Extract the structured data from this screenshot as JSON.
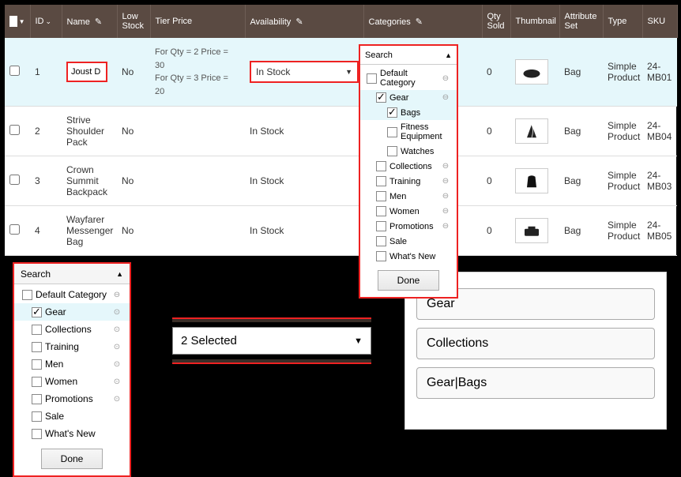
{
  "headers": {
    "id": "ID",
    "name": "Name",
    "low_stock": "Low Stock",
    "tier_price": "Tier Price",
    "availability": "Availability",
    "categories": "Categories",
    "qty_sold": "Qty Sold",
    "thumbnail": "Thumbnail",
    "attribute_set": "Attribute Set",
    "type": "Type",
    "sku": "SKU"
  },
  "availability_value": "In Stock",
  "category_search_placeholder": "Search",
  "rows": [
    {
      "id": "1",
      "name_input": "Joust D",
      "low": "No",
      "tier1": "For Qty = 2 Price = 30",
      "tier2": "For Qty = 3 Price = 20",
      "avail": "In Stock",
      "qty": "0",
      "attr": "Bag",
      "type": "Simple Product",
      "sku": "24-MB01"
    },
    {
      "id": "2",
      "name": "Strive Shoulder Pack",
      "low": "No",
      "avail": "In Stock",
      "qty": "0",
      "attr": "Bag",
      "type": "Simple Product",
      "sku": "24-MB04"
    },
    {
      "id": "3",
      "name": "Crown Summit Backpack",
      "low": "No",
      "avail": "In Stock",
      "qty": "0",
      "attr": "Bag",
      "type": "Simple Product",
      "sku": "24-MB03"
    },
    {
      "id": "4",
      "name": "Wayfarer Messenger Bag",
      "low": "No",
      "avail": "In Stock",
      "qty": "0",
      "attr": "Bag",
      "type": "Simple Product",
      "sku": "24-MB05"
    }
  ],
  "cat_tree_main": {
    "root": "Default Category",
    "gear": "Gear",
    "bags": "Bags",
    "fitness": "Fitness Equipment",
    "watches": "Watches",
    "collections": "Collections",
    "training": "Training",
    "men": "Men",
    "women": "Women",
    "promotions": "Promotions",
    "sale": "Sale",
    "whats_new": "What's New",
    "done": "Done"
  },
  "cat_tree_2": {
    "root": "Default Category",
    "gear": "Gear",
    "collections": "Collections",
    "training": "Training",
    "men": "Men",
    "women": "Women",
    "promotions": "Promotions",
    "sale": "Sale",
    "whats_new": "What's New",
    "done": "Done"
  },
  "selected_label": "2 Selected",
  "pills": {
    "p1": "Gear",
    "p2": "Collections",
    "p3": "Gear|Bags"
  }
}
